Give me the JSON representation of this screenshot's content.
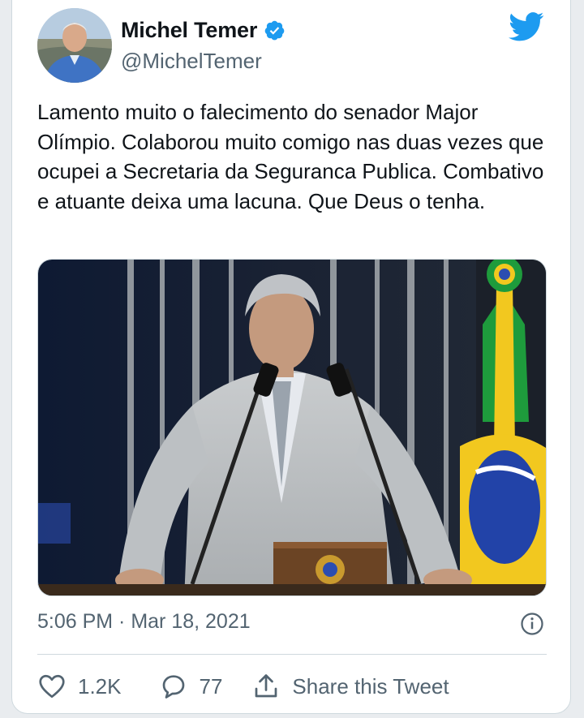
{
  "author": {
    "name": "Michel Temer",
    "handle": "@MichelTemer"
  },
  "tweet": {
    "text": "Lamento muito o falecimento do senador Major Olímpio. Colaborou muito comigo nas duas vezes que ocupei a Secretaria da Seguranca  Publica. Combativo e atuante deixa uma lacuna. Que Deus o tenha."
  },
  "meta": {
    "time": "5:06 PM",
    "separator": " · ",
    "date": "Mar 18, 2021"
  },
  "actions": {
    "likes": "1.2K",
    "replies": "77",
    "share_label": "Share this Tweet"
  },
  "icons": {
    "like": "heart-icon",
    "reply": "speech-bubble-icon",
    "share": "share-icon",
    "info": "info-icon",
    "brand": "twitter-bird-icon",
    "verified": "verified-badge-icon"
  },
  "colors": {
    "twitter_blue": "#1d9bf0",
    "secondary_text": "#536471"
  }
}
